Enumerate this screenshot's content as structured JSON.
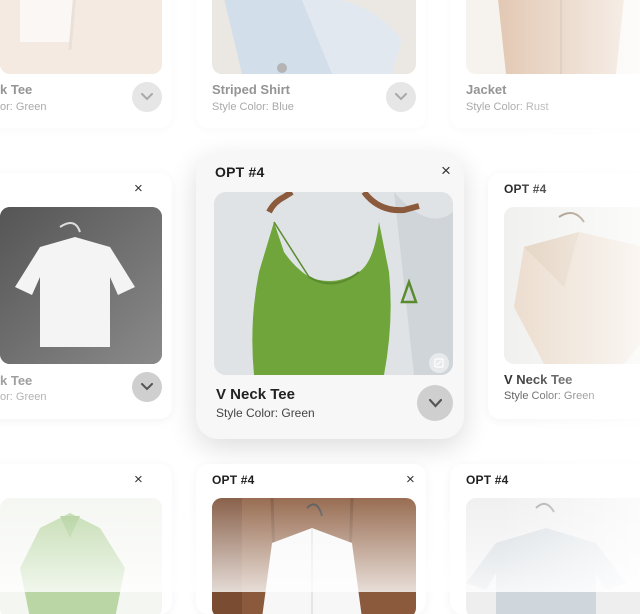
{
  "cards": {
    "top_left": {
      "title": "k Tee",
      "subtitle": "or: Green"
    },
    "top_mid": {
      "title": "Striped Shirt",
      "subtitle": "Style Color: Blue"
    },
    "top_right": {
      "title": "Jacket",
      "subtitle": "Style Color: Rust"
    },
    "mid_left": {
      "title": "k Tee",
      "subtitle": "or: Green"
    },
    "center": {
      "opt": "OPT #4",
      "title": "V Neck Tee",
      "subtitle": "Style Color: Green"
    },
    "mid_right": {
      "opt": "OPT #4",
      "title": "V Neck Tee",
      "subtitle": "Style Color: Green"
    },
    "bottom_mid": {
      "opt": "OPT #4"
    },
    "bottom_right": {
      "opt": "OPT #4"
    }
  },
  "icons": {
    "close": "close-icon",
    "expand": "chevron-down-icon",
    "edit": "edit-icon",
    "close_glyph": "×"
  },
  "colors": {
    "accent_green": "#6fa53a",
    "chevron_bg": "#cfcfcf"
  }
}
